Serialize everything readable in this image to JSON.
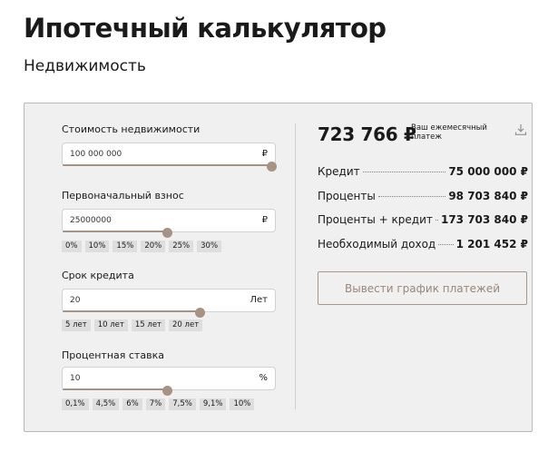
{
  "header": {
    "title": "Ипотечный калькулятор",
    "subtitle": "Недвижимость"
  },
  "inputs": {
    "price": {
      "label": "Стоимость недвижимости",
      "value": "100 000 000",
      "unit": "₽",
      "slider_fraction": 1.0
    },
    "down_payment": {
      "label": "Первоначальный взнос",
      "value": "25000000",
      "unit": "₽",
      "slider_fraction": 0.5,
      "chips": [
        "0%",
        "10%",
        "15%",
        "20%",
        "25%",
        "30%"
      ]
    },
    "term": {
      "label": "Срок кредита",
      "value": "20",
      "unit": "Лет",
      "slider_fraction": 0.66,
      "chips": [
        "5 лет",
        "10 лет",
        "15 лет",
        "20 лет"
      ]
    },
    "rate": {
      "label": "Процентная ставка",
      "value": "10",
      "unit": "%",
      "slider_fraction": 0.5,
      "chips": [
        "0,1%",
        "4,5%",
        "6%",
        "7%",
        "7,5%",
        "9,1%",
        "10%"
      ]
    }
  },
  "result": {
    "monthly_amount": "723 766 ₽",
    "monthly_caption": "Ваш ежемесячный платеж",
    "rows": [
      {
        "label": "Кредит",
        "value": "75 000 000 ₽"
      },
      {
        "label": "Проценты",
        "value": "98 703 840 ₽"
      },
      {
        "label": "Проценты + кредит",
        "value": "173 703 840 ₽"
      },
      {
        "label": "Необходимый доход",
        "value": "1 201 452 ₽"
      }
    ],
    "schedule_button": "Вывести график платежей"
  },
  "colors": {
    "accent": "#a69383",
    "panel_bg": "#f0f0f0",
    "chip_bg": "#dedede"
  },
  "icons": {
    "download": "download-icon"
  }
}
